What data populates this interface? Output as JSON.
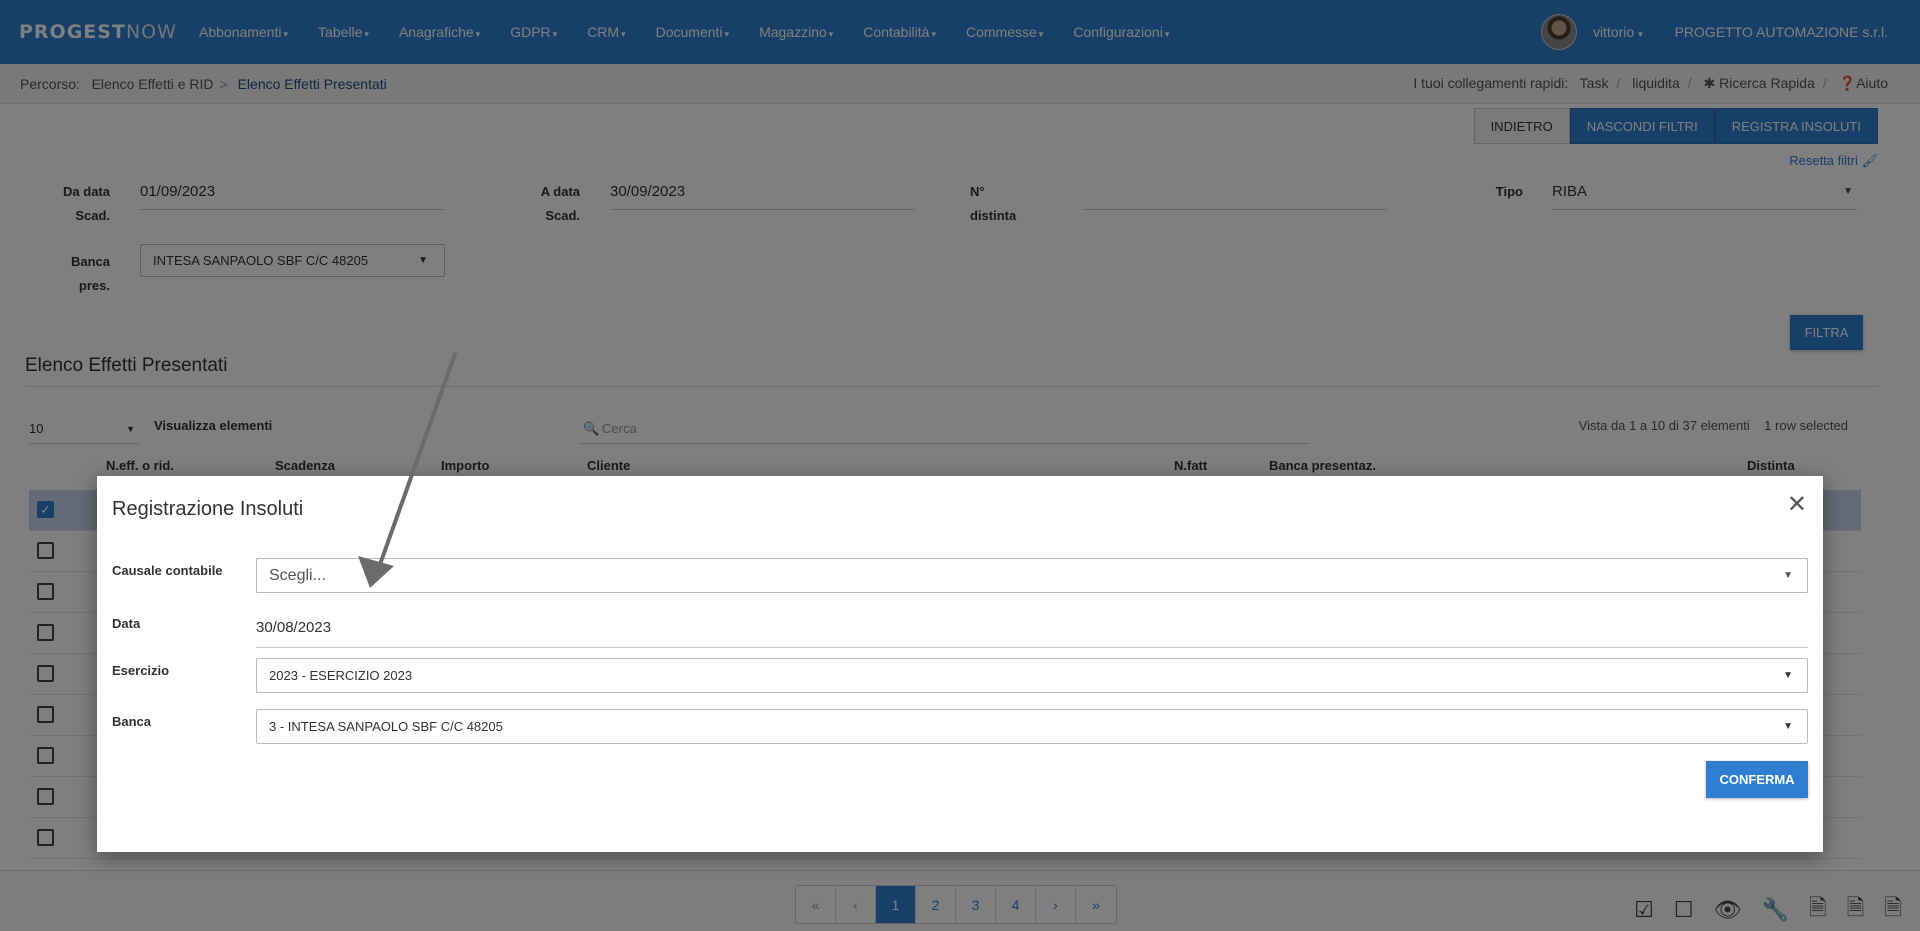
{
  "navbar": {
    "brand_main": "PROGEST",
    "brand_suffix": "NOW",
    "menu": [
      "Abbonamenti",
      "Tabelle",
      "Anagrafiche",
      "GDPR",
      "CRM",
      "Documenti",
      "Magazzino",
      "Contabilità",
      "Commesse",
      "Configurazioni"
    ],
    "user": "vittorio",
    "company": "PROGETTO AUTOMAZIONE s.r.l."
  },
  "breadcrumb": {
    "label": "Percorso:",
    "items": [
      "Elenco Effetti e RID",
      "Elenco Effetti Presentati"
    ]
  },
  "quick_links": {
    "label": "I tuoi collegamenti rapidi:",
    "items": [
      "Task",
      "liquidita",
      "Ricerca Rapida",
      "Aiuto"
    ]
  },
  "toolbar": {
    "back": "INDIETRO",
    "hide_filters": "NASCONDI FILTRI",
    "register": "REGISTRA INSOLUTI",
    "reset_filters": "Resetta filtri"
  },
  "filters": {
    "from_date_label_1": "Da data",
    "from_date_label_2": "Scad.",
    "from_date": "01/09/2023",
    "to_date_label_1": "A data",
    "to_date_label_2": "Scad.",
    "to_date": "30/09/2023",
    "distinta_label": "N° distinta",
    "distinta": "",
    "tipo_label": "Tipo",
    "tipo": "RIBA",
    "banca_label_1": "Banca",
    "banca_label_2": "pres.",
    "banca": "INTESA SANPAOLO SBF C/C 48205",
    "filter_button": "FILTRA"
  },
  "list": {
    "title": "Elenco Effetti Presentati",
    "page_length": "10",
    "page_length_label": "Visualizza elementi",
    "search_placeholder": "Cerca",
    "info": "Vista da 1 a 10 di 37 elementi",
    "selected_info": "1 row selected",
    "columns": [
      "N.eff. o rid.",
      "Scadenza",
      "Importo",
      "Cliente",
      "N.fatt",
      "Banca presentaz.",
      "Distinta"
    ]
  },
  "pagination": {
    "first": "«",
    "prev": "‹",
    "pages": [
      "1",
      "2",
      "3",
      "4"
    ],
    "next": "›",
    "last": "»",
    "active": "1"
  },
  "modal": {
    "title": "Registrazione Insoluti",
    "causale_label": "Causale contabile",
    "causale_placeholder": "Scegli...",
    "data_label": "Data",
    "data_value": "30/08/2023",
    "esercizio_label": "Esercizio",
    "esercizio_value": "2023 - ESERCIZIO 2023",
    "banca_label": "Banca",
    "banca_value": "3 - INTESA SANPAOLO SBF C/C 48205",
    "confirm": "CONFERMA"
  },
  "colors": {
    "primary": "#2f7ed1",
    "selected_row": "#c8d7ef"
  }
}
